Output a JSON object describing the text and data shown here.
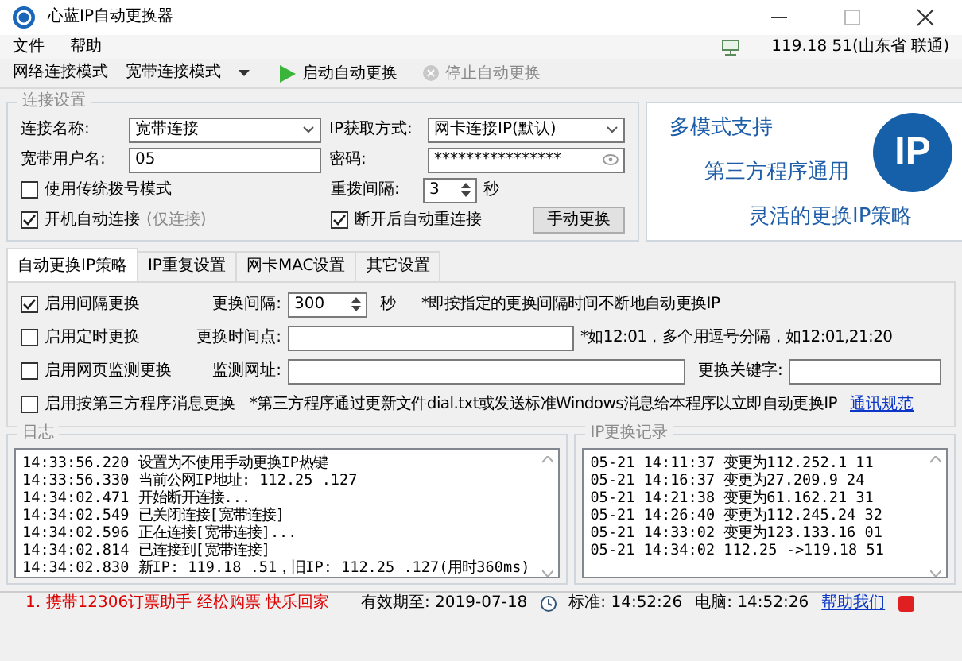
{
  "window": {
    "title": "心蓝IP自动更换器"
  },
  "menu": [
    "文件",
    "帮助"
  ],
  "ip_status": "119.18 51(山东省 联通)",
  "toolbar": {
    "mode_label": "网络连接模式",
    "mode_value": "宽带连接模式",
    "start_button": {
      "label": "启动自动更换",
      "disabled": false
    },
    "stop_button": {
      "label": "停止自动更换",
      "disabled": true
    }
  },
  "connection_settings": {
    "title": "连接设置",
    "connection_name": {
      "label": "连接名称:",
      "value": "宽带连接"
    },
    "ip_method": {
      "label": "IP获取方式:",
      "value": "网卡连接IP(默认)"
    },
    "username": {
      "label": "宽带用户名:",
      "value": "05"
    },
    "password": {
      "label": "密码:",
      "value": "****************"
    },
    "dialup_mode": {
      "label": "使用传统拨号模式",
      "checked": false
    },
    "redial": {
      "label": "重拨间隔:",
      "value": "3",
      "unit": "秒"
    },
    "autostart": {
      "label": "开机自动连接",
      "note": "(仅连接)",
      "checked": true
    },
    "reconnect": {
      "label": "断开后自动重连接",
      "checked": true
    },
    "manual_button": "手动更换"
  },
  "banner": {
    "lines": [
      "多模式支持",
      "第三方程序通用",
      "灵活的更换IP策略"
    ],
    "logo": "IP"
  },
  "tabs": [
    {
      "label": "自动更换IP策略",
      "selected": true
    },
    {
      "label": "IP重复设置",
      "selected": false
    },
    {
      "label": "网卡MAC设置",
      "selected": false
    },
    {
      "label": "其它设置",
      "selected": false
    }
  ],
  "strategies": [
    {
      "kind": "spinner",
      "label": "启用间隔更换",
      "checked": true,
      "field_label": "更换间隔:",
      "field_value": "300",
      "unit": "秒",
      "note": "*即按指定的更换间隔时间不断地自动更换IP"
    },
    {
      "kind": "text",
      "label": "启用定时更换",
      "checked": false,
      "field_label": "更换时间点:",
      "note": "*如12:01，多个用逗号分隔，如12:01,21:20"
    },
    {
      "kind": "text_keyword",
      "label": "启用网页监测更换",
      "checked": false,
      "field_label": "监测网址:",
      "extra_label": "更换关键字:"
    },
    {
      "kind": "note",
      "label": "启用按第三方程序消息更换",
      "checked": false,
      "note": "*第三方程序通过更新文件dial.txt或发送标准Windows消息给本程序以立即自动更换IP",
      "link": "通讯规范"
    }
  ],
  "log": {
    "title": "日志",
    "lines": [
      "14:33:56.220 设置为不使用手动更换IP热键",
      "14:33:56.330 当前公网IP地址: 112.25 .127",
      "14:34:02.471 开始断开连接...",
      "14:34:02.549 已关闭连接[宽带连接]",
      "14:34:02.596 正在连接[宽带连接]...",
      "14:34:02.814 已连接到[宽带连接]",
      "14:34:02.830 新IP: 119.18 .51，旧IP: 112.25 .127(用时360ms)"
    ]
  },
  "ip_log": {
    "title": "IP更换记录",
    "lines": [
      "05-21 14:11:37 变更为112.252.1 11",
      "05-21 14:16:37 变更为27.209.9 24",
      "05-21 14:21:38 变更为61.162.21 31",
      "05-21 14:26:40 变更为112.245.24 32",
      "05-21 14:33:02 变更为123.133.16 01",
      "05-21 14:34:02   112.25  ->119.18 51"
    ]
  },
  "status_bar": {
    "notice": "1. 携带12306订票助手 经松购票 快乐回家",
    "expiry": "有效期至: 2019-07-18",
    "standard_time": "标准: 14:52:26",
    "pc_time": "电脑: 14:52:26",
    "help_link": "帮助我们"
  }
}
